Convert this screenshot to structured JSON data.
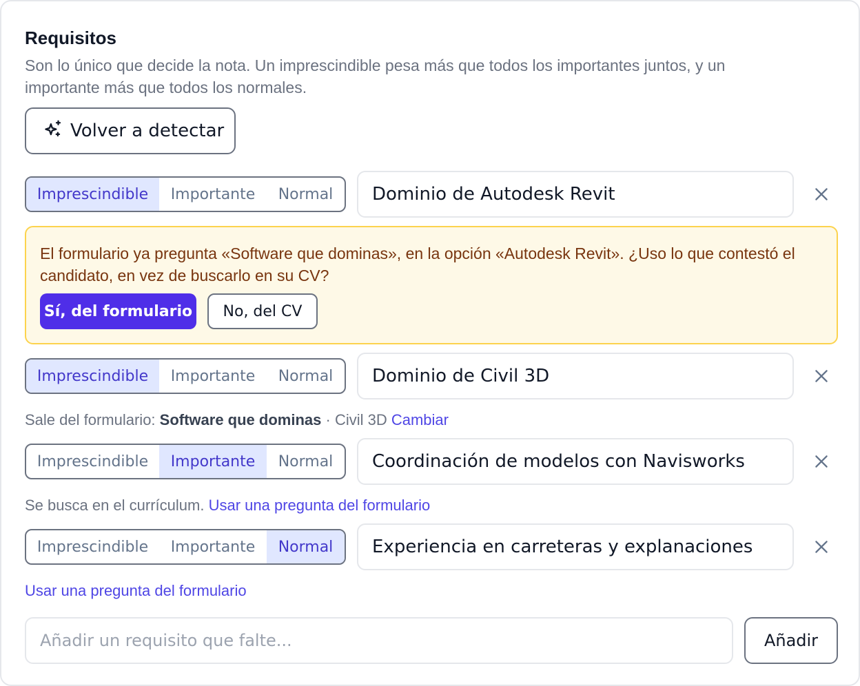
{
  "section": {
    "title": "Requisitos",
    "description": "Son lo único que decide la nota. Un imprescindible pesa más que todos los importantes juntos, y un importante más que todos los normales."
  },
  "redetect_label": "Volver a detectar",
  "levels": [
    "Imprescindible",
    "Importante",
    "Normal"
  ],
  "requirements": [
    {
      "text": "Dominio de Autodesk Revit",
      "level": "Imprescindible"
    },
    {
      "text": "Dominio de Civil 3D",
      "level": "Imprescindible"
    },
    {
      "text": "Coordinación de modelos con Navisworks",
      "level": "Importante"
    },
    {
      "text": "Experiencia en carreteras y explanaciones",
      "level": "Normal"
    }
  ],
  "alert": {
    "text": "El formulario ya pregunta «Software que dominas», en la opción «Autodesk Revit». ¿Uso lo que contestó el candidato, en vez de buscarlo en su CV?",
    "yes_label": "Sí, del formulario",
    "no_label": "No, del CV"
  },
  "note2": {
    "prefix": "Sale del formulario: ",
    "question": "Software que dominas",
    "separator": " · ",
    "option": "Civil 3D",
    "link": "Cambiar"
  },
  "note3": {
    "text": "Se busca en el currículum. ",
    "link": "Usar una pregunta del formulario"
  },
  "note4": {
    "link": "Usar una pregunta del formulario"
  },
  "add": {
    "placeholder": "Añadir un requisito que falte...",
    "button_label": "Añadir"
  },
  "colors": {
    "accent": "#4f2ee8",
    "active_segment_bg": "#e0e7ff",
    "alert_bg": "#fef9e7",
    "alert_border": "#fcd34d"
  },
  "icons": {
    "redetect": "sparkles-icon",
    "remove": "close-icon"
  }
}
